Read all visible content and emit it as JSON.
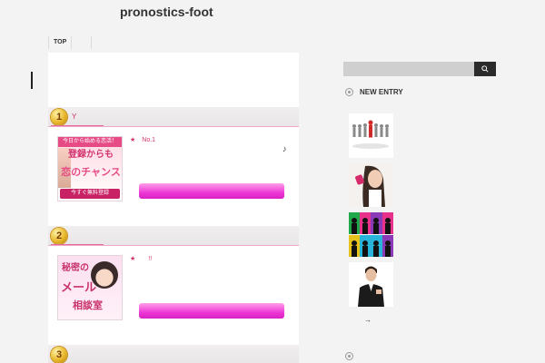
{
  "site": {
    "title": "pronostics-foot"
  },
  "breadcrumb": {
    "items": [
      "TOP"
    ]
  },
  "rankings": [
    {
      "rank": "1",
      "title": "Y",
      "star_text": "★　No.1",
      "note": "♪",
      "banner": {
        "top_text": "今日から始める恋活！",
        "main_text": "登録からも",
        "sub_text": "恋のチャンス",
        "button_text": "今すぐ無料登録"
      }
    },
    {
      "rank": "2",
      "title": "",
      "star_text": "★　　!!",
      "banner": {
        "line1": "秘密の",
        "line2": "メール",
        "line3": "相談室"
      }
    },
    {
      "rank": "3",
      "title": ""
    }
  ],
  "sidebar": {
    "search": {
      "placeholder": ""
    },
    "new_entry_heading": "NEW ENTRY",
    "arrow": "→"
  },
  "colors": {
    "accent_pink": "#ee38d6",
    "rank_text": "#c8336f",
    "search_button": "#2b2b2b"
  }
}
